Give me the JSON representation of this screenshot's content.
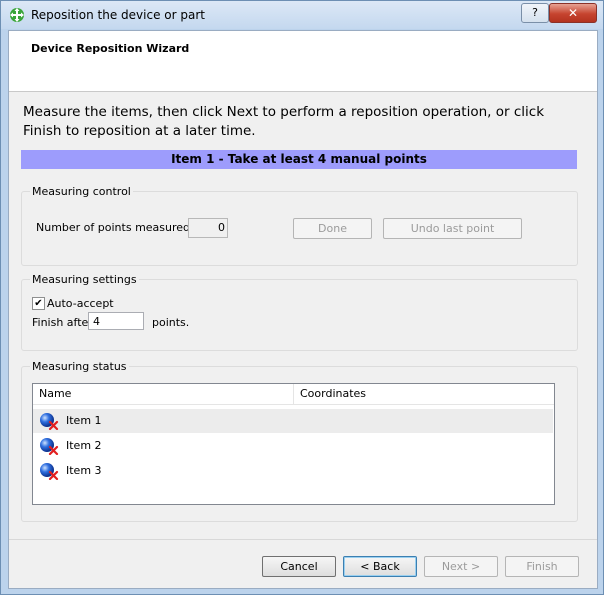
{
  "window": {
    "title": "Reposition the device or part",
    "help_label": "?",
    "close_label": "✕"
  },
  "wizard": {
    "title": "Device Reposition Wizard"
  },
  "instructions": "Measure the items, then click Next to perform a reposition operation, or click Finish to reposition at a later time.",
  "banner": {
    "text": "Item 1 - Take at least 4 manual points",
    "color": "#9d9cfc"
  },
  "measuring_control": {
    "title": "Measuring control",
    "points_label": "Number of points measured:",
    "points_value": "0",
    "done_label": "Done",
    "undo_label": "Undo last point"
  },
  "measuring_settings": {
    "title": "Measuring settings",
    "auto_accept_label": "Auto-accept",
    "auto_accept_checked": true,
    "finish_after_label": "Finish after",
    "finish_after_value": "4",
    "points_suffix": "points."
  },
  "measuring_status": {
    "title": "Measuring status",
    "columns": [
      "Name",
      "Coordinates"
    ],
    "rows": [
      {
        "name": "Item 1",
        "coordinates": "",
        "icon": "sphere-error-icon"
      },
      {
        "name": "Item 2",
        "coordinates": "",
        "icon": "sphere-error-icon"
      },
      {
        "name": "Item 3",
        "coordinates": "",
        "icon": "sphere-error-icon"
      }
    ]
  },
  "footer": {
    "cancel_label": "Cancel",
    "back_label": "< Back",
    "next_label": "Next >",
    "finish_label": "Finish"
  }
}
